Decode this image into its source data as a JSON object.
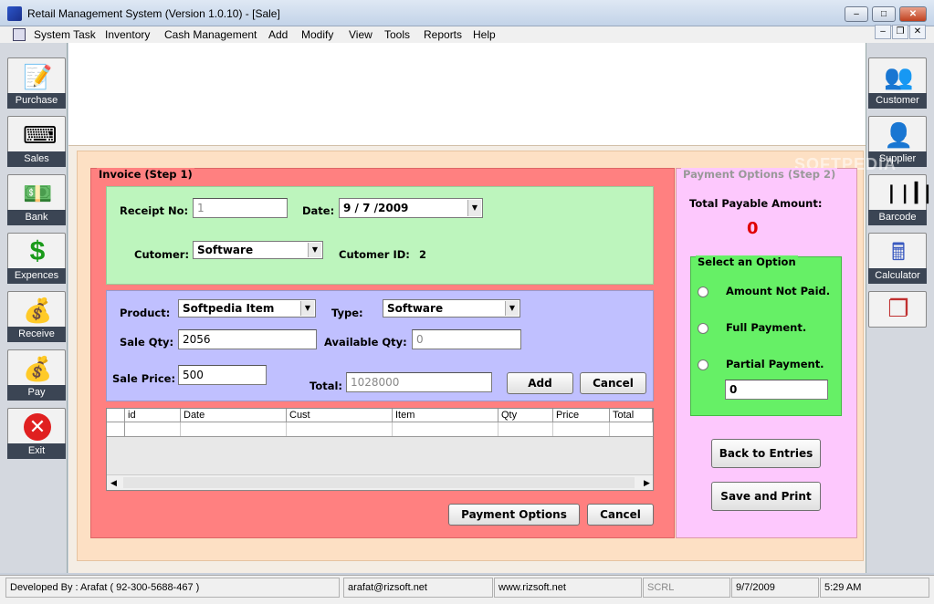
{
  "window": {
    "title": "Retail Management System (Version 1.0.10) - [Sale]"
  },
  "menu": [
    "System Task",
    "Inventory",
    "Cash Management",
    "Add",
    "Modify",
    "View",
    "Tools",
    "Reports",
    "Help"
  ],
  "left_toolbar": [
    "Purchase",
    "Sales",
    "Bank",
    "Expences",
    "Receive",
    "Pay",
    "Exit"
  ],
  "right_toolbar": [
    "Customer",
    "Supplier",
    "Barcode",
    "Calculator"
  ],
  "watermark": "SOFTPEDIA",
  "invoice": {
    "legend": "Invoice (Step 1)",
    "receipt_label": "Receipt No:",
    "receipt_value": "1",
    "date_label": "Date:",
    "date_value": "9 / 7 /2009",
    "customer_label": "Cutomer:",
    "customer_value": "Software",
    "customer_id_label": "Cutomer ID:",
    "customer_id_value": "2",
    "product_label": "Product:",
    "product_value": "Softpedia Item",
    "type_label": "Type:",
    "type_value": "Software",
    "sale_qty_label": "Sale Qty:",
    "sale_qty_value": "2056",
    "available_qty_label": "Available Qty:",
    "available_qty_value": "0",
    "sale_price_label": "Sale Price:",
    "sale_price_value": "500",
    "total_label": "Total:",
    "total_value": "1028000",
    "add_button": "Add",
    "cancel_button": "Cancel",
    "grid_columns": [
      "id",
      "Date",
      "Cust",
      "Item",
      "Qty",
      "Price",
      "Total"
    ],
    "payment_options_button": "Payment Options",
    "cancel2_button": "Cancel"
  },
  "payment": {
    "legend": "Payment Options (Step 2)",
    "total_payable_label": "Total Payable Amount:",
    "total_payable_value": "0",
    "select_legend": "Select an Option",
    "options": [
      "Amount Not Paid.",
      "Full Payment.",
      "Partial Payment."
    ],
    "partial_value": "0",
    "back_button": "Back to Entries",
    "save_button": "Save and Print"
  },
  "status": {
    "developer": "Developed By : Arafat ( 92-300-5688-467 )",
    "email": "arafat@rizsoft.net",
    "website": "www.rizsoft.net",
    "scroll": "SCRL",
    "date": "9/7/2009",
    "time": "5:29 AM"
  },
  "colors": {
    "invoice_panel": "#ff8080",
    "green_box": "#bdf5bd",
    "blue_box": "#c0c0ff",
    "payment_panel": "#fdc8fd",
    "option_box": "#66f066",
    "total_amount": "#e00000"
  }
}
